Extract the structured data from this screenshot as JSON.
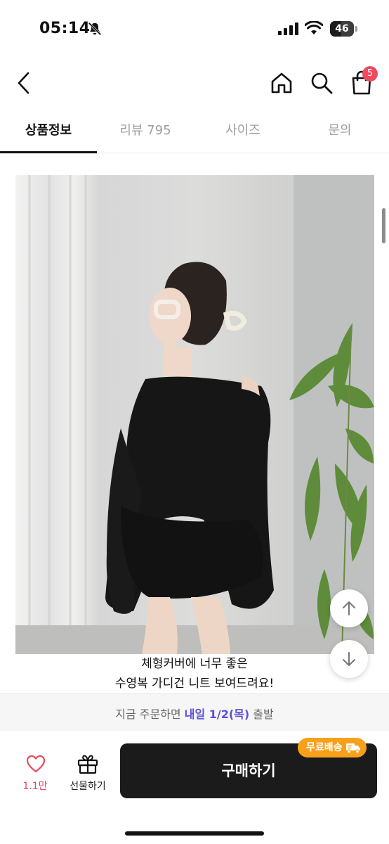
{
  "status_bar": {
    "time": "05:14",
    "battery_level": "46",
    "icons": [
      "bell-off-icon",
      "signal-icon",
      "wifi-icon",
      "battery-icon"
    ]
  },
  "header": {
    "icons": [
      "back-icon",
      "home-icon",
      "search-icon",
      "cart-icon"
    ],
    "cart_count": "5"
  },
  "tabs": [
    {
      "label": "상품정보",
      "active": true
    },
    {
      "label": "리뷰 795",
      "active": false
    },
    {
      "label": "사이즈",
      "active": false
    },
    {
      "label": "문의",
      "active": false
    }
  ],
  "caption": {
    "line1": "체형커버에 너무 좋은",
    "line2": "수영복 가디건 니트 보여드려요!"
  },
  "delivery": {
    "prefix": "지금 주문하면 ",
    "highlight": "내일 1/2(목)",
    "suffix": " 출발"
  },
  "bottom_bar": {
    "like_count": "1.1만",
    "gift_label": "선물하기",
    "buy_label": "구매하기",
    "free_shipping_badge": "무료배송"
  },
  "colors": {
    "badge": "#f04a5f",
    "delivery_highlight": "#5b4fd6",
    "free_shipping": "#f7a11a",
    "buy_button": "#1b1b1b"
  }
}
